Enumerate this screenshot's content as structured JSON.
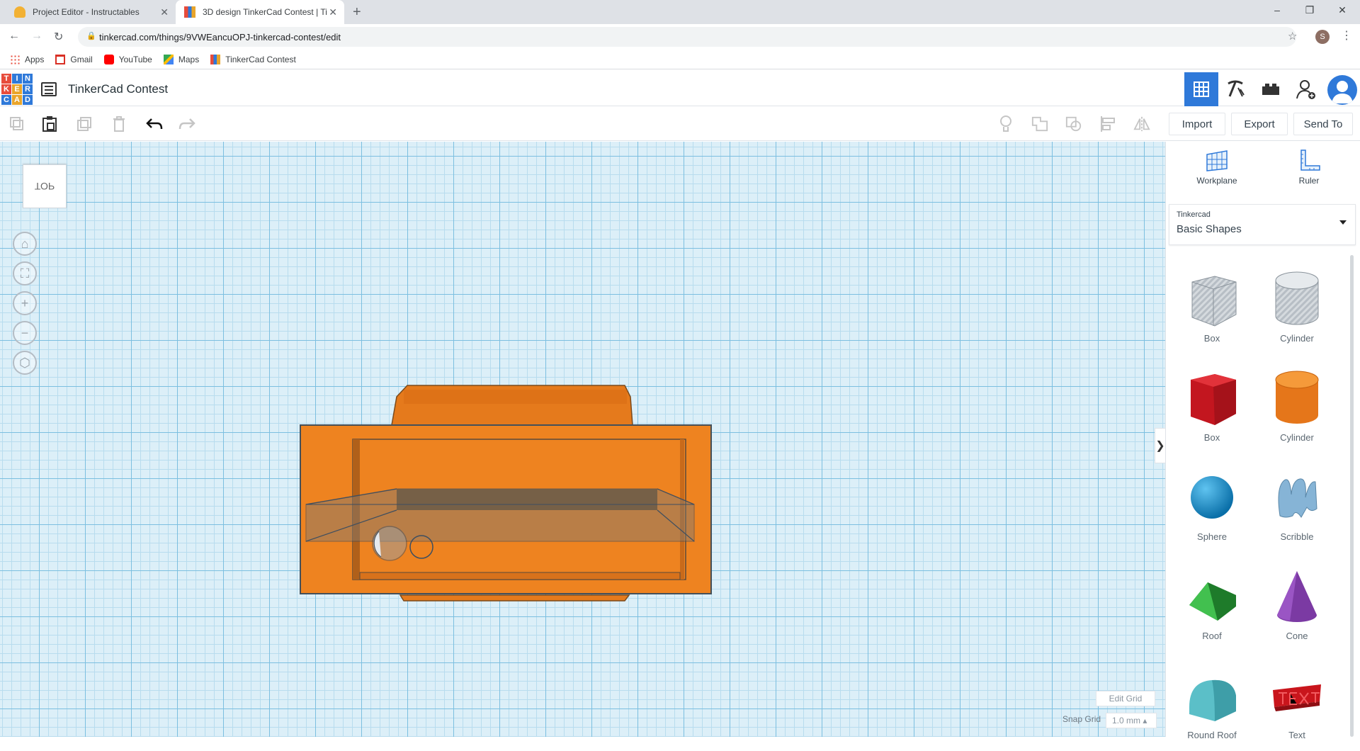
{
  "browser": {
    "tabs": [
      {
        "title": "Project Editor - Instructables",
        "active": false
      },
      {
        "title": "3D design TinkerCad Contest | Ti",
        "active": true
      }
    ],
    "url": "tinkercad.com/things/9VWEancuOPJ-tinkercad-contest/edit",
    "profile_initial": "S",
    "bookmarks": [
      "Apps",
      "Gmail",
      "YouTube",
      "Maps",
      "TinkerCad Contest"
    ]
  },
  "app": {
    "logo_letters": [
      "T",
      "I",
      "N",
      "K",
      "E",
      "R",
      "C",
      "A",
      "D"
    ],
    "logo_colors": [
      "#e74c3c",
      "#2f79d9",
      "#2f79d9",
      "#e74c3c",
      "#e9a52b",
      "#2f79d9",
      "#2f79d9",
      "#e9a52b",
      "#2f79d9"
    ],
    "design_title": "TinkerCad Contest",
    "accent_color": "#2f79d9"
  },
  "actions": {
    "import": "Import",
    "export": "Export",
    "send_to": "Send To"
  },
  "workplane": {
    "viewcube_label": "TOP",
    "edit_grid": "Edit Grid",
    "snap_label": "Snap Grid",
    "snap_value": "1.0 mm",
    "model_color": "#ea7a1f"
  },
  "sidebar": {
    "tools": [
      {
        "label": "Workplane",
        "icon": "workplane-icon"
      },
      {
        "label": "Ruler",
        "icon": "ruler-icon"
      }
    ],
    "library_category": "Tinkercad",
    "library_name": "Basic Shapes",
    "shapes": [
      {
        "label": "Box",
        "icon": "box-hole-icon",
        "color": "#b8bfc6"
      },
      {
        "label": "Cylinder",
        "icon": "cylinder-hole-icon",
        "color": "#c4cbd2"
      },
      {
        "label": "Box",
        "icon": "box-icon",
        "color": "#d9202a"
      },
      {
        "label": "Cylinder",
        "icon": "cylinder-icon",
        "color": "#e9801e"
      },
      {
        "label": "Sphere",
        "icon": "sphere-icon",
        "color": "#1a8fd0"
      },
      {
        "label": "Scribble",
        "icon": "scribble-icon",
        "color": "#7aa7c9"
      },
      {
        "label": "Roof",
        "icon": "roof-icon",
        "color": "#2fa63b"
      },
      {
        "label": "Cone",
        "icon": "cone-icon",
        "color": "#7b3aa3"
      },
      {
        "label": "Round Roof",
        "icon": "round-roof-icon",
        "color": "#5bbfc8"
      },
      {
        "label": "Text",
        "icon": "text-icon",
        "color": "#c9151c"
      }
    ]
  }
}
